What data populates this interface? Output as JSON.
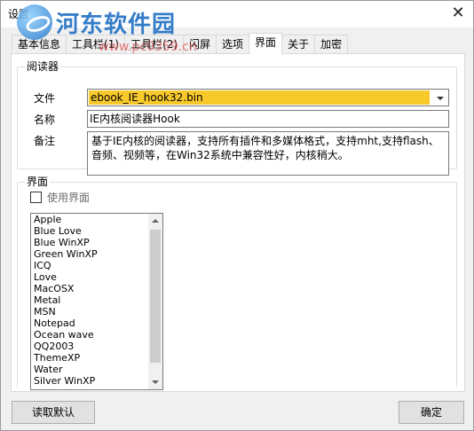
{
  "window": {
    "title": "设置",
    "close_glyph": "✕"
  },
  "watermark": {
    "title": "河东软件园",
    "url": "www.pc0359.cn"
  },
  "tabs": [
    {
      "label": "基本信息"
    },
    {
      "label": "工具栏(1)"
    },
    {
      "label": "工具栏(2)"
    },
    {
      "label": "闪屏"
    },
    {
      "label": "选项"
    },
    {
      "label": "界面",
      "active": true
    },
    {
      "label": "关于"
    },
    {
      "label": "加密"
    }
  ],
  "reader": {
    "group_title": "阅读器",
    "file_label": "文件",
    "file_value": "ebook_IE_hook32.bin",
    "name_label": "名称",
    "name_value": "IE内核阅读器Hook",
    "note_label": "备注",
    "note_value": "基于IE内核的阅读器，支持所有插件和多媒体格式，支持mht,支持flash、音频、视频等，在Win32系统中兼容性好，内核稍大。"
  },
  "interface": {
    "group_title": "界面",
    "use_skin_label": "使用界面",
    "use_skin_checked": false,
    "skins": [
      "Apple",
      "Blue Love",
      "Blue WinXP",
      "Green WinXP",
      "ICQ",
      "Love",
      "MacOSX",
      "Metal",
      "MSN",
      "Notepad",
      "Ocean wave",
      "QQ2003",
      "ThemeXP",
      "Water",
      "Silver WinXP"
    ]
  },
  "buttons": {
    "load_default": "读取默认",
    "ok": "确定"
  },
  "colors": {
    "selection_highlight": "#f7c92a",
    "watermark_title": "#1f6fc4"
  }
}
